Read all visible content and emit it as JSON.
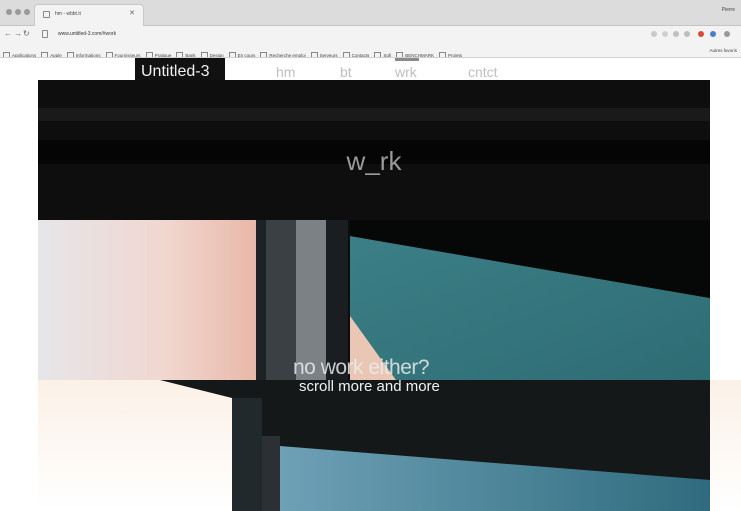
{
  "browser": {
    "tab_title": "hm - wbbt.it",
    "url": "www.untitled-3.com/#work",
    "profile": "Pierre",
    "bookmarks": [
      "Applications",
      "Apple",
      "Informations",
      "Fournisseurs",
      "Pratique",
      "Bank",
      "Design",
      "En cours",
      "Recherche emploi",
      "Serveurs",
      "Contacts",
      "Sofi",
      "BENCHMARK",
      "Projets"
    ],
    "bookmarks_right": "Autres favoris"
  },
  "site": {
    "brand": "Untitled-3",
    "nav": [
      {
        "label": "hm"
      },
      {
        "label": "bt"
      },
      {
        "label": "wrk"
      },
      {
        "label": "cntct"
      }
    ],
    "section_title": "w_rk",
    "hero_title": "no work either?",
    "hero_subtitle": "scroll more and more"
  },
  "colors": {
    "frame": "#12394a",
    "band": "#0e0e0e",
    "teal_glass": "#3a7a80"
  }
}
